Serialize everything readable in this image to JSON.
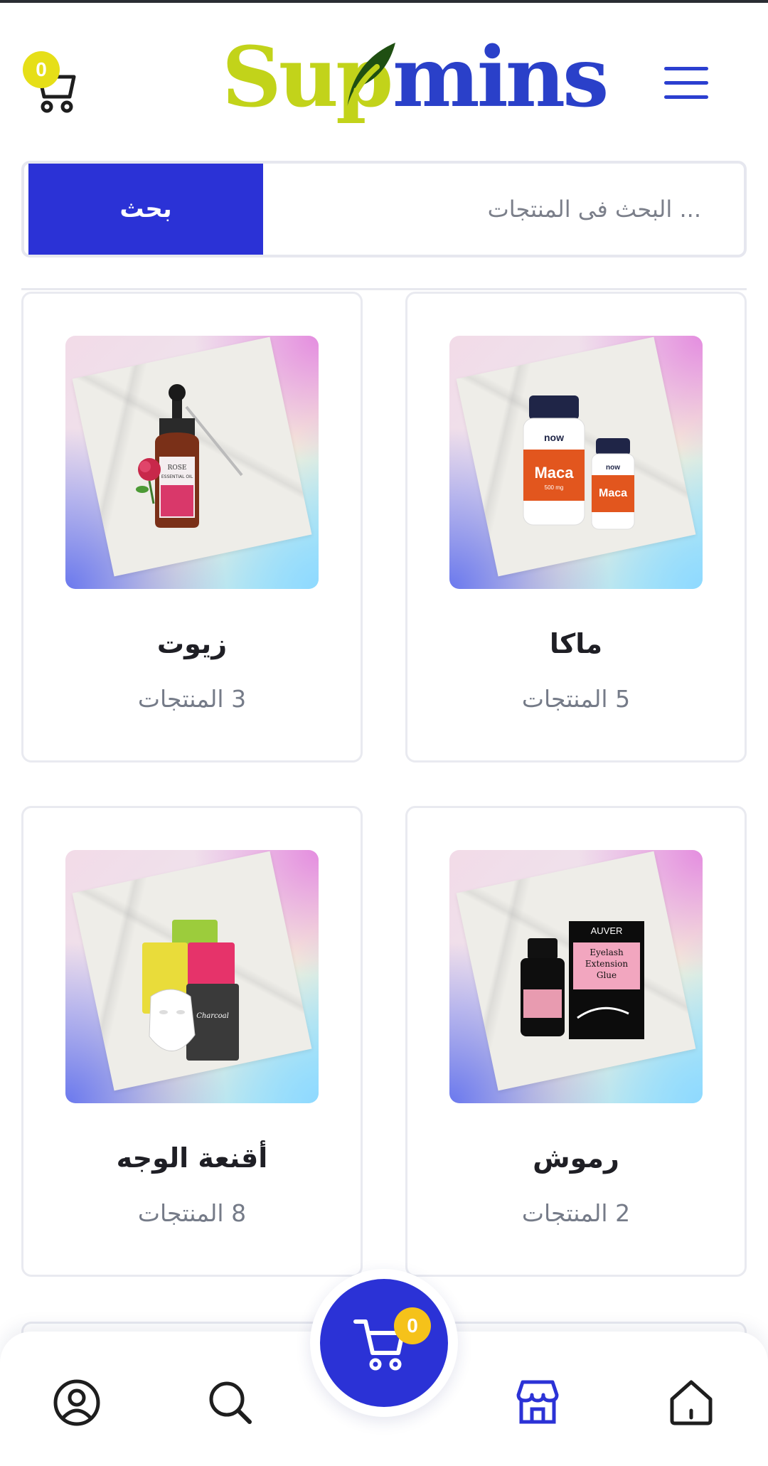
{
  "header": {
    "cart_count": "0",
    "logo_part1": "Sup",
    "logo_part2": "mins"
  },
  "search": {
    "placeholder": "... البحث فى المنتجات",
    "button_label": "بحث"
  },
  "categories": [
    {
      "name": "زيوت",
      "count_label": "3 المنتجات",
      "image": "rose-essential-oil"
    },
    {
      "name": "ماكا",
      "count_label": "5 المنتجات",
      "image": "maca-capsules"
    },
    {
      "name": "أقنعة الوجه",
      "count_label": "8 المنتجات",
      "image": "face-sheet-masks"
    },
    {
      "name": "رموش",
      "count_label": "2 المنتجات",
      "image": "eyelash-glue"
    }
  ],
  "floating_cart": {
    "count": "0"
  },
  "bottom_nav": [
    {
      "icon": "user-icon"
    },
    {
      "icon": "search-icon"
    },
    {
      "icon": "store-icon"
    },
    {
      "icon": "home-icon"
    }
  ],
  "colors": {
    "primary": "#2b32d6",
    "logo_green": "#c2d31a",
    "logo_blue": "#2a40c9",
    "badge_yellow": "#e6df18"
  }
}
